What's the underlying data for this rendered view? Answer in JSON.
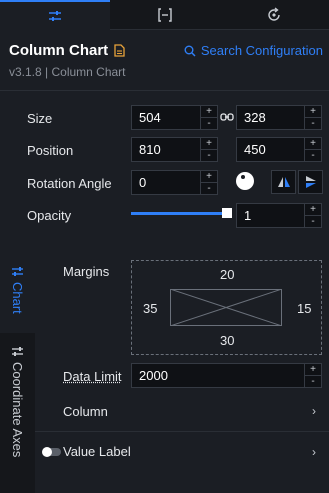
{
  "tabs": [
    {
      "icon": "sliders-icon"
    },
    {
      "icon": "bracket-icon"
    },
    {
      "icon": "refresh-icon"
    }
  ],
  "header": {
    "title": "Column Chart",
    "subtitle": "v3.1.8 | Column Chart",
    "search_label": "Search Configuration"
  },
  "size": {
    "label": "Size",
    "width": "504",
    "height": "328"
  },
  "position": {
    "label": "Position",
    "x": "810",
    "y": "450"
  },
  "rotation": {
    "label": "Rotation Angle",
    "value": "0"
  },
  "opacity": {
    "label": "Opacity",
    "value": "1",
    "level": 1
  },
  "stepper": {
    "plus": "+",
    "minus": "-"
  },
  "side_tabs": {
    "chart": "Chart",
    "axes": "Coordinate Axes"
  },
  "margins": {
    "label": "Margins",
    "top": "20",
    "left": "35",
    "right": "15",
    "bottom": "30"
  },
  "data_limit": {
    "label": "Data Limit",
    "value": "2000"
  },
  "sections": {
    "column": "Column",
    "value_label": "Value Label",
    "chevron": "›"
  },
  "colors": {
    "accent": "#2f7ff7",
    "background": "#1b1e24",
    "doc_icon": "#e8a33a"
  }
}
